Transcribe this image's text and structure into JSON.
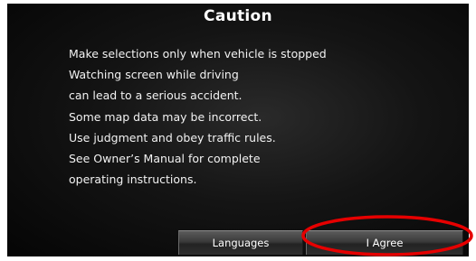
{
  "dialog": {
    "title": "Caution",
    "lines": [
      "Make selections only when vehicle is stopped",
      "Watching screen while driving",
      "can lead to a serious accident.",
      "Some map data may be incorrect.",
      "Use judgment and obey traffic rules.",
      "See Owner’s Manual for complete",
      "operating instructions."
    ]
  },
  "buttons": {
    "languages_label": "Languages",
    "agree_label": "I Agree"
  },
  "colors": {
    "background": "#0a0a0a",
    "text": "#ffffff",
    "highlight_ring": "#e60000"
  }
}
